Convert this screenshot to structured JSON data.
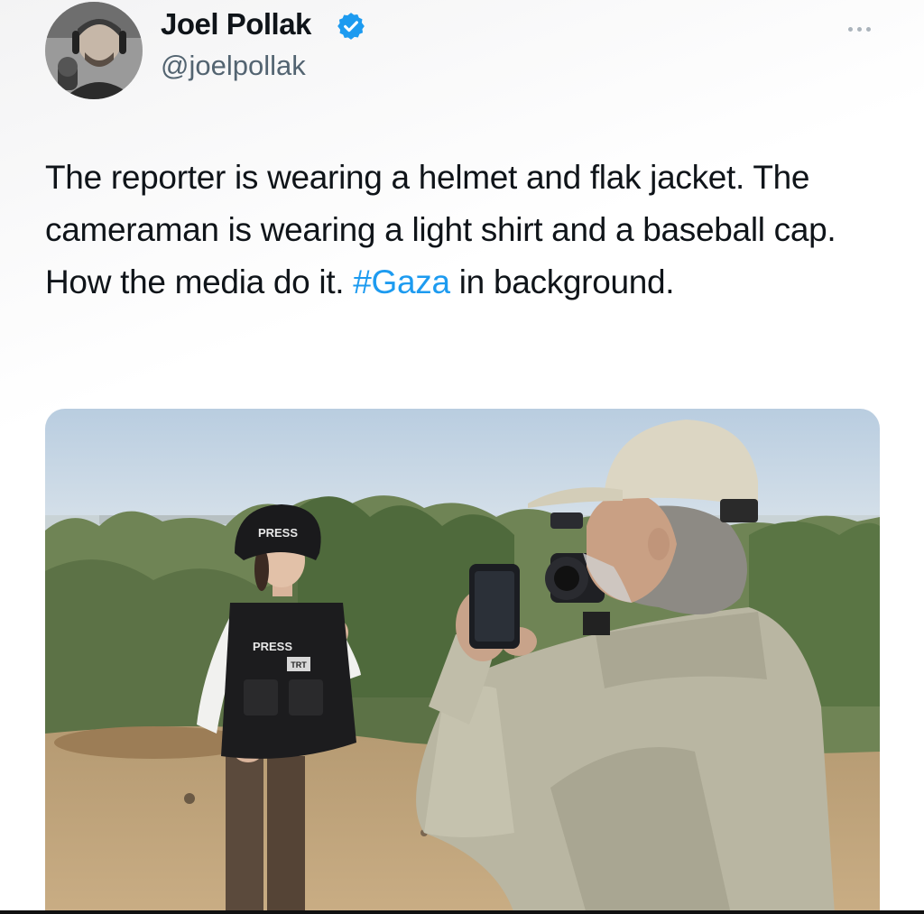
{
  "author": {
    "display_name": "Joel Pollak",
    "handle": "@joelpollak",
    "verified": true,
    "avatar_icon": "avatar-photo-icon",
    "verified_icon": "verified-badge-icon"
  },
  "tweet": {
    "text_before_hashtag": "The reporter is wearing a helmet and flak jacket. The cameraman is wearing a light shirt and a baseball cap. How the media do it. ",
    "hashtag": "#Gaza",
    "text_after_hashtag": " in background."
  },
  "media": {
    "vest_label": "PRESS",
    "helmet_label": "PRESS",
    "badge_label": "TRT"
  },
  "colors": {
    "link": "#1d9bf0",
    "verified": "#1d9bf0",
    "secondary_text": "#536471"
  },
  "menu": {
    "icon": "more-options-icon"
  }
}
